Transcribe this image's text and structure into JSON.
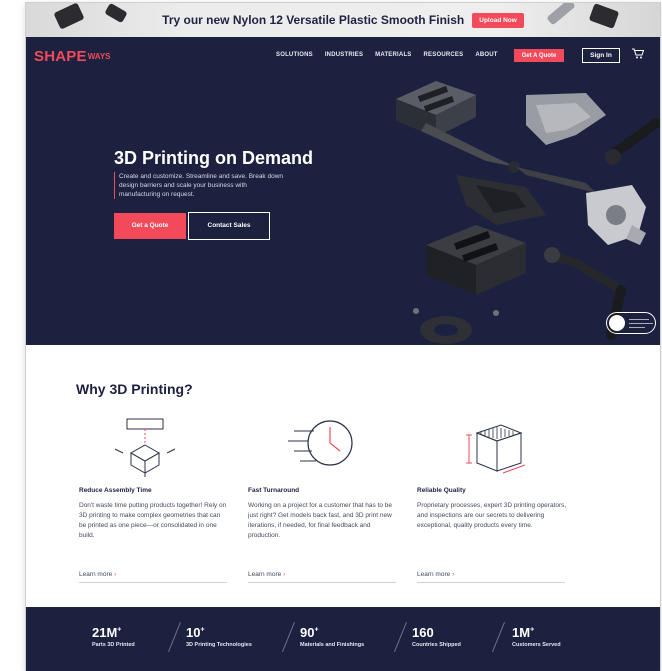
{
  "promo": {
    "text": "Try our new Nylon 12 Versatile Plastic Smooth Finish",
    "button": "Upload Now"
  },
  "header": {
    "logo": "SHAPE",
    "logo_suffix": "WAYS",
    "menu": [
      "SOLUTIONS",
      "INDUSTRIES",
      "MATERIALS",
      "RESOURCES",
      "ABOUT"
    ],
    "quote_button": "Get A Quote",
    "signin_button": "Sign In",
    "cart_icon": "cart-icon"
  },
  "hero": {
    "title": "3D Printing on Demand",
    "body": "Create and customize. Streamline and save. Break down design barriers and scale your business with manufacturing on request.",
    "cta_primary": "Get a Quote",
    "cta_secondary": "Contact Sales"
  },
  "why": {
    "title": "Why 3D Printing?",
    "features": [
      {
        "icon": "assembly-cube-icon",
        "heading": "Reduce Assembly Time",
        "body": "Don't waste time putting products together! Rely on 3D printing to make complex geometries that can be printed as one piece—or consolidated in one build.",
        "link": "Learn more"
      },
      {
        "icon": "stopwatch-icon",
        "heading": "Fast Turnaround",
        "body": "Working on a project for a customer that has to be just right? Get models back fast, and 3D print new iterations, if needed, for final feedback and production.",
        "link": "Learn more"
      },
      {
        "icon": "quality-box-icon",
        "heading": "Reliable Quality",
        "body": "Proprietary processes, expert 3D printing operators, and inspections are our secrets to delivering exceptional, quality products every time.",
        "link": "Learn more"
      }
    ]
  },
  "stats": [
    {
      "value": "21M",
      "plus": "+",
      "label": "Parts 3D Printed"
    },
    {
      "value": "10",
      "plus": "+",
      "label": "3D Printing Technologies"
    },
    {
      "value": "90",
      "plus": "+",
      "label": "Materials and Finishings"
    },
    {
      "value": "160",
      "plus": "",
      "label": "Countries Shipped"
    },
    {
      "value": "1M",
      "plus": "+",
      "label": "Customers Served"
    }
  ],
  "colors": {
    "navy": "#1c2140",
    "accent": "#f24a5a"
  }
}
